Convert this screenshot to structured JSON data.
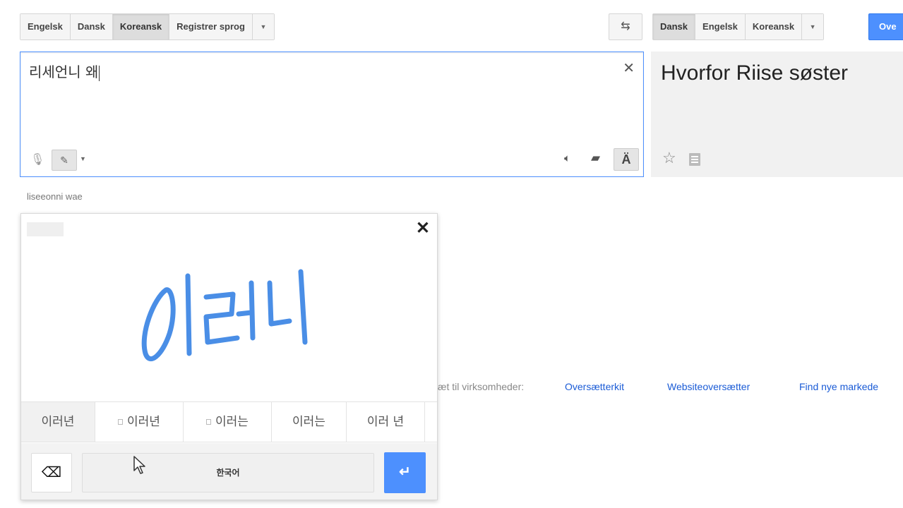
{
  "source_languages": {
    "items": [
      "Engelsk",
      "Dansk",
      "Koreansk",
      "Registrer sprog"
    ],
    "active": "Koreansk",
    "dropdown_icon": "chevron-down-icon"
  },
  "swap_icon": "swap-languages-icon",
  "target_languages": {
    "items": [
      "Dansk",
      "Engelsk",
      "Koreansk"
    ],
    "active": "Dansk",
    "dropdown_icon": "chevron-down-icon"
  },
  "translate_button": {
    "label": "Ove"
  },
  "source": {
    "text": "리세언니 왜",
    "transliteration": "liseeonni wae",
    "icons": [
      "close-icon",
      "microphone-icon",
      "pencil-icon",
      "speaker-icon",
      "comment-icon",
      "keyboard-icon"
    ]
  },
  "result": {
    "text": "Hvorfor Riise søster",
    "icons": [
      "star-icon",
      "document-icon"
    ]
  },
  "footer": {
    "prefix": "æt til virksomheder:",
    "links": [
      "Oversætterkit",
      "Websiteoversætter",
      "Find nye markede"
    ]
  },
  "handwriting": {
    "drawn_text": "이러니",
    "ink_color": "#4a8ee6",
    "candidates": [
      "이러년",
      "이러년",
      "이러는",
      "이러는",
      "이러 년"
    ],
    "space_label": "한국어",
    "backspace_icon": "backspace-icon",
    "enter_icon": "enter-icon"
  },
  "colors": {
    "accent": "#4d90fe",
    "link": "#1a5bd6"
  }
}
